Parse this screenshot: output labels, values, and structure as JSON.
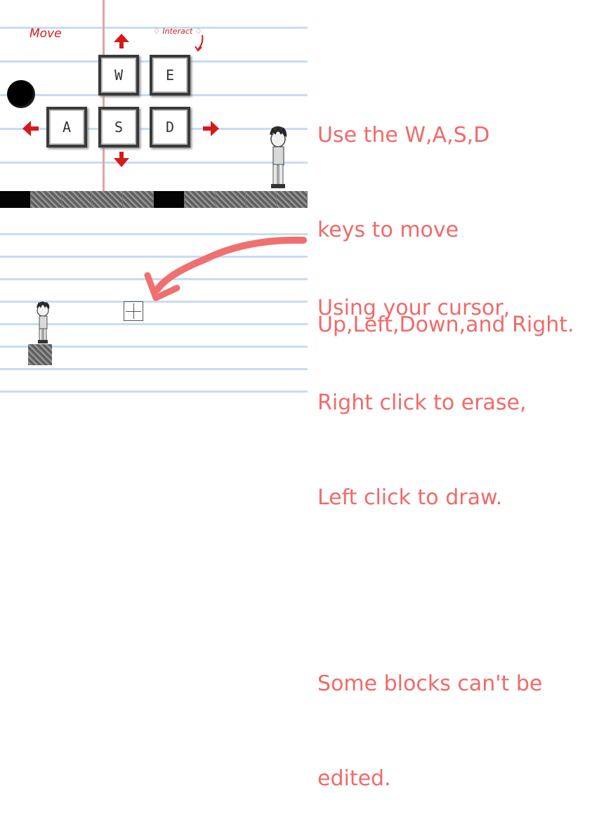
{
  "controls_panel": {
    "move_label": "Move",
    "interact_label": "♢ Interact ♢",
    "keys": {
      "w": "W",
      "e": "E",
      "a": "A",
      "s": "S",
      "d": "D"
    }
  },
  "instructions_move": {
    "line1": "Use the W,A,S,D",
    "line2": "keys to move",
    "line3": "Up,Left,Down,and Right."
  },
  "instructions_draw": {
    "line1": "Using your cursor,",
    "line2": "Right click to erase,",
    "line3": "Left click to draw.",
    "line4": "Some blocks can't be",
    "line5": "edited."
  },
  "colors": {
    "instruction_text": "#f06a68",
    "annotation_red": "#d61a1a",
    "notebook_rule": "#c7dcf5",
    "margin_line": "#e3a3a3"
  },
  "icons": [
    "arrow-up-icon",
    "arrow-down-icon",
    "arrow-left-icon",
    "arrow-right-icon",
    "curved-arrow-icon",
    "crosshair-cursor-icon"
  ]
}
